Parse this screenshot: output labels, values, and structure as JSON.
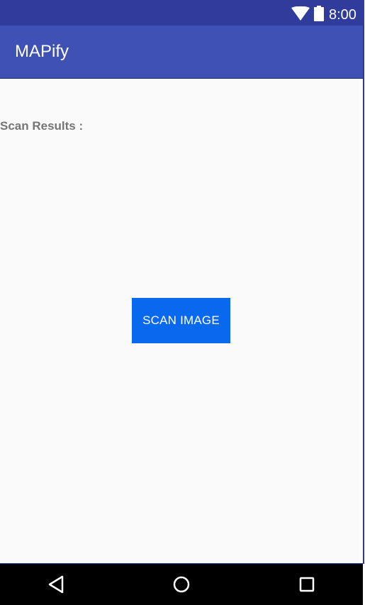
{
  "status_bar": {
    "time": "8:00",
    "icons": [
      "wifi-icon",
      "battery-icon"
    ]
  },
  "app_bar": {
    "title": "MAPify"
  },
  "main": {
    "scan_results_label": "Scan Results :",
    "scan_button_label": "SCAN IMAGE"
  },
  "nav_bar": {
    "icons": [
      "back-icon",
      "home-icon",
      "recents-icon"
    ]
  },
  "colors": {
    "status_bar": "#2f3c9b",
    "app_bar": "#3f51b5",
    "button": "#0869ee",
    "background": "#fafafa",
    "label_text": "#757575"
  }
}
